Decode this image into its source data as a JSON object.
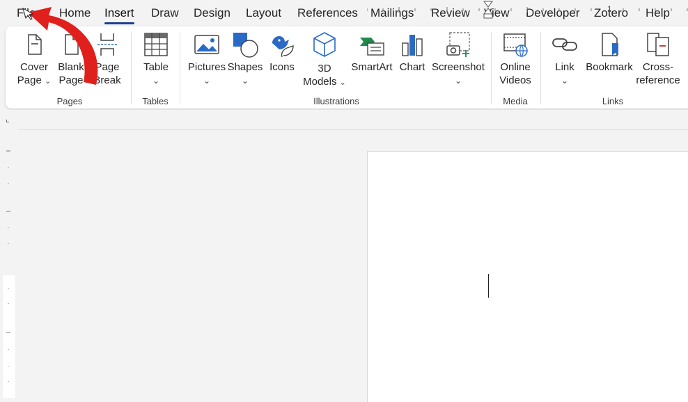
{
  "tabs": [
    {
      "label": "File"
    },
    {
      "label": "Home"
    },
    {
      "label": "Insert",
      "active": true
    },
    {
      "label": "Draw"
    },
    {
      "label": "Design"
    },
    {
      "label": "Layout"
    },
    {
      "label": "References"
    },
    {
      "label": "Mailings"
    },
    {
      "label": "Review"
    },
    {
      "label": "View"
    },
    {
      "label": "Developer"
    },
    {
      "label": "Zotero"
    },
    {
      "label": "Help"
    }
  ],
  "ribbon": {
    "pages": {
      "label": "Pages",
      "cover_page": {
        "line1": "Cover",
        "line2": "Page"
      },
      "blank_page": {
        "line1": "Blank",
        "line2": "Page"
      },
      "page_break": {
        "line1": "Page",
        "line2": "Break"
      }
    },
    "tables": {
      "label": "Tables",
      "table": "Table"
    },
    "illustrations": {
      "label": "Illustrations",
      "pictures": "Pictures",
      "shapes": "Shapes",
      "icons": "Icons",
      "models": {
        "line1": "3D",
        "line2": "Models"
      },
      "smartart": "SmartArt",
      "chart": "Chart",
      "screenshot": "Screenshot"
    },
    "media": {
      "label": "Media",
      "online_videos": {
        "line1": "Online",
        "line2": "Videos"
      }
    },
    "links": {
      "label": "Links",
      "link": "Link",
      "bookmark": "Bookmark",
      "cross_reference": {
        "line1": "Cross-",
        "line2": "reference"
      }
    }
  },
  "ruler": {
    "mark": "1"
  },
  "colors": {
    "accent": "#1e3f8f",
    "arrow": "#e0201c",
    "ribbon_bg": "#ffffff",
    "app_bg": "#f3f3f3"
  }
}
